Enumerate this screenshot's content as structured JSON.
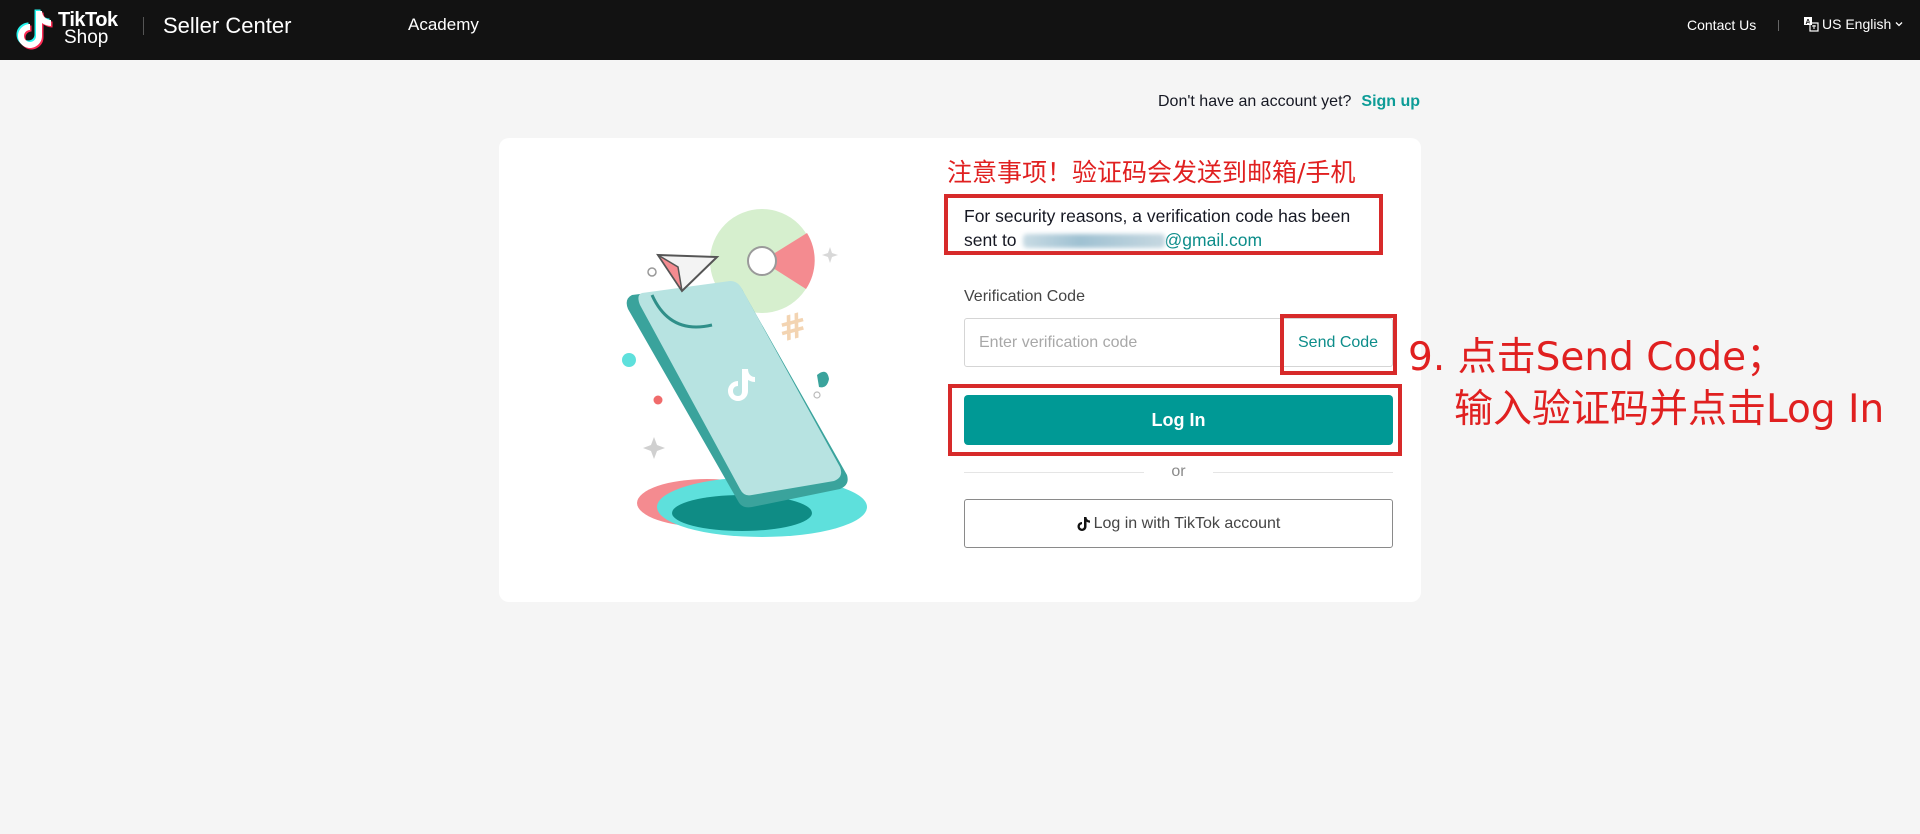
{
  "header": {
    "logo_line1": "TikTok",
    "logo_line2": "Shop",
    "brand": "Seller Center",
    "nav_academy": "Academy",
    "contact_us": "Contact Us",
    "language": "US English",
    "icons": {
      "logo": "tiktok-logo-icon",
      "language": "translate-icon",
      "dropdown": "chevron-down-icon"
    }
  },
  "signup": {
    "prompt": "Don't have an account yet?",
    "link": "Sign up"
  },
  "annotations": {
    "notice": "注意事项！验证码会发送到邮箱/手机",
    "step_line1": "9. 点击Send Code；",
    "step_line2": "输入验证码并点击Log In",
    "highlight_color": "#d72a2a"
  },
  "login_form": {
    "security_message": "For security reasons, a verification code has been sent to",
    "email_domain": "@gmail.com",
    "verification_label": "Verification Code",
    "verification_placeholder": "Enter verification code",
    "verification_value": "",
    "send_code": "Send Code",
    "login_button": "Log In",
    "divider": "or",
    "tiktok_login": "Log in with TikTok account"
  },
  "colors": {
    "accent": "#009995",
    "link": "#0d9c97",
    "topbar": "#121212",
    "annotation": "#e02020"
  }
}
